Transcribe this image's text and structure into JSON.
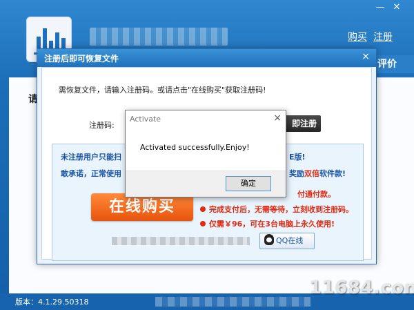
{
  "main_window": {
    "buy_link": "购买",
    "register_link": "注册",
    "rate_label": "评价",
    "panel_heading": "请",
    "version": "版本：4.1.29.50318"
  },
  "watermark": "11684.com",
  "reg_dialog": {
    "title": "注册后即可恢复文件",
    "close": "×",
    "instruction": "需恢复文件，请输入注册码。或请点击\"在线购买\"获取注册码!",
    "code_label": "注册码:",
    "code_value": "",
    "register_button": "即注册",
    "promo": {
      "line1_left": "未注册用户只能扫",
      "line1_right": "E版!",
      "line2_left": "敢承诺，正常使用",
      "line2_right_prefix": "奖励",
      "line2_right_highlight": "双倍",
      "line2_right_suffix": "软件款!",
      "buy_button": "在线购买",
      "bullet1": "付通付款。",
      "bullet2": "完成支付后，无需等待，立刻收到注册码。",
      "bullet3": "仅需￥96，可在3台电脑上永久使用!",
      "qq_button": "QQ在线"
    }
  },
  "activate_popup": {
    "title": "Activate",
    "close": "×",
    "message": "Activated successfully.Enjoy!",
    "ok_button": "确定"
  }
}
